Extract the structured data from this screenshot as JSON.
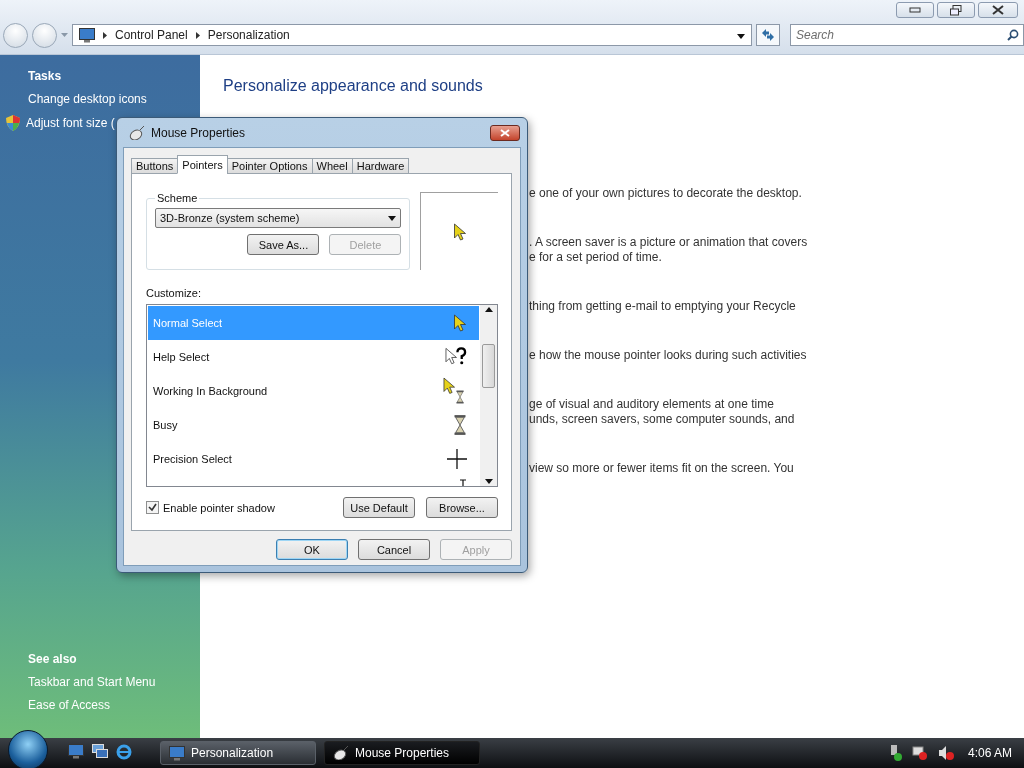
{
  "address": {
    "breadcrumbs": [
      "Control Panel",
      "Personalization"
    ]
  },
  "search": {
    "placeholder": "Search"
  },
  "sidebar": {
    "tasks_heading": "Tasks",
    "tasks": [
      {
        "label": "Change desktop icons",
        "kind": "plain"
      },
      {
        "label": "Adjust font size (",
        "kind": "shield"
      }
    ],
    "see_also_heading": "See also",
    "see_also": [
      {
        "label": "Taskbar and Start Menu"
      },
      {
        "label": "Ease of Access"
      }
    ]
  },
  "content": {
    "heading": "Personalize appearance and sounds",
    "descriptions": [
      [
        "e one of your own pictures to decorate the desktop."
      ],
      [
        ". A screen saver is a picture or animation that covers",
        "e for a set period of time."
      ],
      [
        "thing from getting e-mail to emptying your Recycle"
      ],
      [
        "e how the mouse pointer looks during such activities"
      ],
      [
        "ge of visual and auditory elements at one time",
        "unds, screen savers, some computer sounds, and"
      ],
      [
        "view so more or fewer items fit on the screen. You"
      ]
    ]
  },
  "dialog": {
    "title": "Mouse Properties",
    "tabs": [
      {
        "label": "Buttons",
        "selected": false
      },
      {
        "label": "Pointers",
        "selected": true
      },
      {
        "label": "Pointer Options",
        "selected": false
      },
      {
        "label": "Wheel",
        "selected": false
      },
      {
        "label": "Hardware",
        "selected": false
      }
    ],
    "scheme": {
      "legend": "Scheme",
      "value": "3D-Bronze (system scheme)"
    },
    "scheme_buttons": [
      {
        "label": "Save As...",
        "disabled": false
      },
      {
        "label": "Delete",
        "disabled": true
      }
    ],
    "customize_label": "Customize:",
    "pointers": [
      {
        "name": "Normal Select",
        "kind": "arrow",
        "selected": true
      },
      {
        "name": "Help Select",
        "kind": "help",
        "selected": false
      },
      {
        "name": "Working In Background",
        "kind": "working",
        "selected": false
      },
      {
        "name": "Busy",
        "kind": "busy",
        "selected": false
      },
      {
        "name": "Precision Select",
        "kind": "cross",
        "selected": false
      },
      {
        "kind": "text"
      }
    ],
    "shadow": {
      "label": "Enable pointer shadow",
      "checked": true
    },
    "pointer_buttons": [
      {
        "label": "Use Default",
        "disabled": false
      },
      {
        "label": "Browse...",
        "disabled": false
      }
    ],
    "buttons": [
      {
        "label": "OK",
        "disabled": false,
        "default": true
      },
      {
        "label": "Cancel",
        "disabled": false,
        "default": false
      },
      {
        "label": "Apply",
        "disabled": true,
        "default": false
      }
    ]
  },
  "taskbar": {
    "tasks": [
      {
        "label": "Personalization",
        "kind": "monitor",
        "selected": false
      },
      {
        "label": "Mouse Properties",
        "kind": "mouse",
        "selected": true
      }
    ],
    "clock": "4:06 AM"
  }
}
